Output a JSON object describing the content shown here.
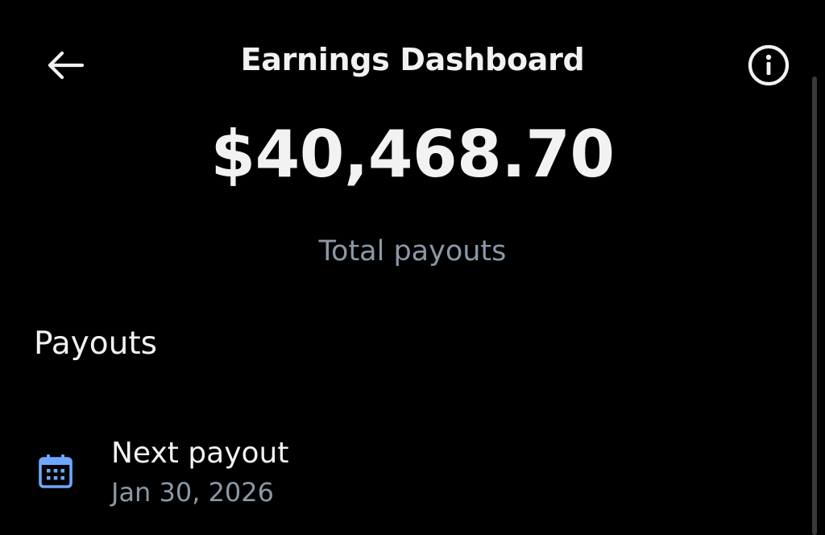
{
  "header": {
    "title": "Earnings Dashboard",
    "back_icon": "arrow-left-icon",
    "info_icon": "info-circle-icon"
  },
  "summary": {
    "total_amount": "$40,468.70",
    "total_label": "Total payouts"
  },
  "payouts": {
    "heading": "Payouts",
    "items": [
      {
        "icon": "calendar-icon",
        "title": "Next payout",
        "date": "Jan 30, 2026"
      }
    ]
  },
  "colors": {
    "background": "#000000",
    "primary_text": "#f2f2f2",
    "secondary_text": "#8b98a5",
    "icon_accent": "#6ea8fe"
  }
}
